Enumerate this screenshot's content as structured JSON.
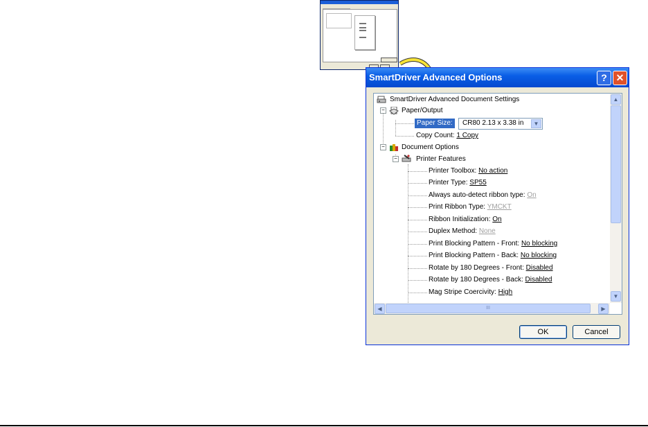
{
  "dialog": {
    "title": "SmartDriver Advanced Options",
    "help_label": "?",
    "close_label": "✕",
    "ok_label": "OK",
    "cancel_label": "Cancel"
  },
  "tree": {
    "root": "SmartDriver Advanced Document Settings",
    "paper_output": "Paper/Output",
    "paper_size_label": "Paper Size:",
    "paper_size_value": "CR80 2.13 x 3.38 in",
    "copy_count_label": "Copy Count:",
    "copy_count_value": "1 Copy",
    "document_options": "Document Options",
    "printer_features": "Printer Features",
    "settings": [
      {
        "label": "Printer Toolbox:",
        "value": "No action",
        "disabled": false
      },
      {
        "label": "Printer Type:",
        "value": "SP55",
        "disabled": false
      },
      {
        "label": "Always auto-detect ribbon type:",
        "value": "On",
        "disabled": true
      },
      {
        "label": "Print Ribbon Type:",
        "value": "YMCKT",
        "disabled": true
      },
      {
        "label": "Ribbon Initialization:",
        "value": "On",
        "disabled": false
      },
      {
        "label": "Duplex Method:",
        "value": "None",
        "disabled": true
      },
      {
        "label": "Print Blocking Pattern - Front:",
        "value": "No blocking",
        "disabled": false
      },
      {
        "label": "Print Blocking Pattern - Back:",
        "value": "No blocking",
        "disabled": false
      },
      {
        "label": "Rotate by 180 Degrees - Front:",
        "value": "Disabled",
        "disabled": false
      },
      {
        "label": "Rotate by 180 Degrees - Back:",
        "value": "Disabled",
        "disabled": false
      },
      {
        "label": "Mag Stripe Coercivity:",
        "value": "High",
        "disabled": false
      }
    ]
  },
  "icons": {
    "collapse": "−",
    "combo_arrow": "▼",
    "scroll_up": "▲",
    "scroll_down": "▼",
    "scroll_left": "◀",
    "scroll_right": "▶",
    "grip": "III"
  }
}
